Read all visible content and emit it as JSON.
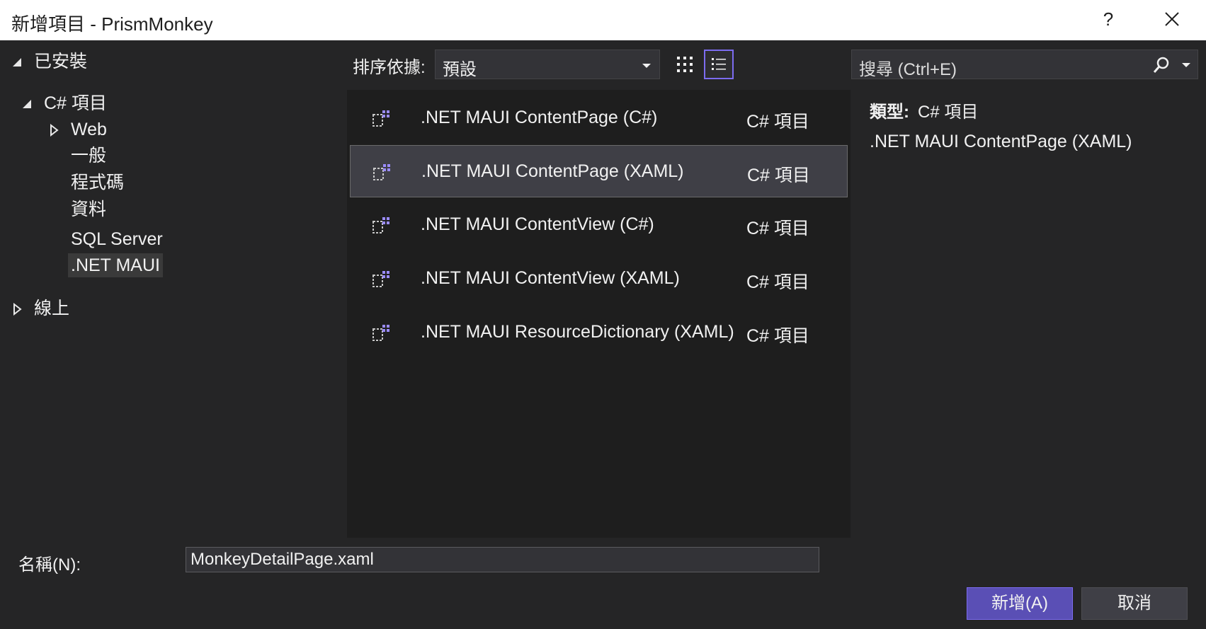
{
  "window": {
    "title": "新增項目 - PrismMonkey",
    "help_label": "?"
  },
  "tree": {
    "installed": "已安裝",
    "csharp_items": "C# 項目",
    "web": "Web",
    "general": "一般",
    "code": "程式碼",
    "data": "資料",
    "sql_server": "SQL Server",
    "net_maui": ".NET MAUI",
    "online": "線上"
  },
  "toolbar": {
    "sort_label": "排序依據:",
    "sort_value": "預設"
  },
  "items": [
    {
      "name": ".NET MAUI ContentPage (C#)",
      "type": "C# 項目"
    },
    {
      "name": ".NET MAUI ContentPage (XAML)",
      "type": "C# 項目"
    },
    {
      "name": ".NET MAUI ContentView (C#)",
      "type": "C# 項目"
    },
    {
      "name": ".NET MAUI ContentView (XAML)",
      "type": "C# 項目"
    },
    {
      "name": ".NET MAUI ResourceDictionary (XAML)",
      "type": "C# 項目"
    }
  ],
  "selected_index": 1,
  "search": {
    "placeholder": "搜尋 (Ctrl+E)"
  },
  "detail": {
    "type_label": "類型:",
    "type_value": "C# 項目",
    "description": ".NET MAUI ContentPage (XAML)"
  },
  "bottom": {
    "name_label": "名稱(N):",
    "name_value": "MonkeyDetailPage.xaml",
    "add_button": "新增(A)",
    "cancel_button": "取消"
  },
  "colors": {
    "accent": "#7c6cf0",
    "primary_button": "#5a4fb5",
    "background": "#252526"
  },
  "icons": {
    "close": "close-icon",
    "list_view": "list-view-icon",
    "grid_view": "grid-view-icon",
    "search": "search-icon",
    "item": "maui-item-icon"
  }
}
